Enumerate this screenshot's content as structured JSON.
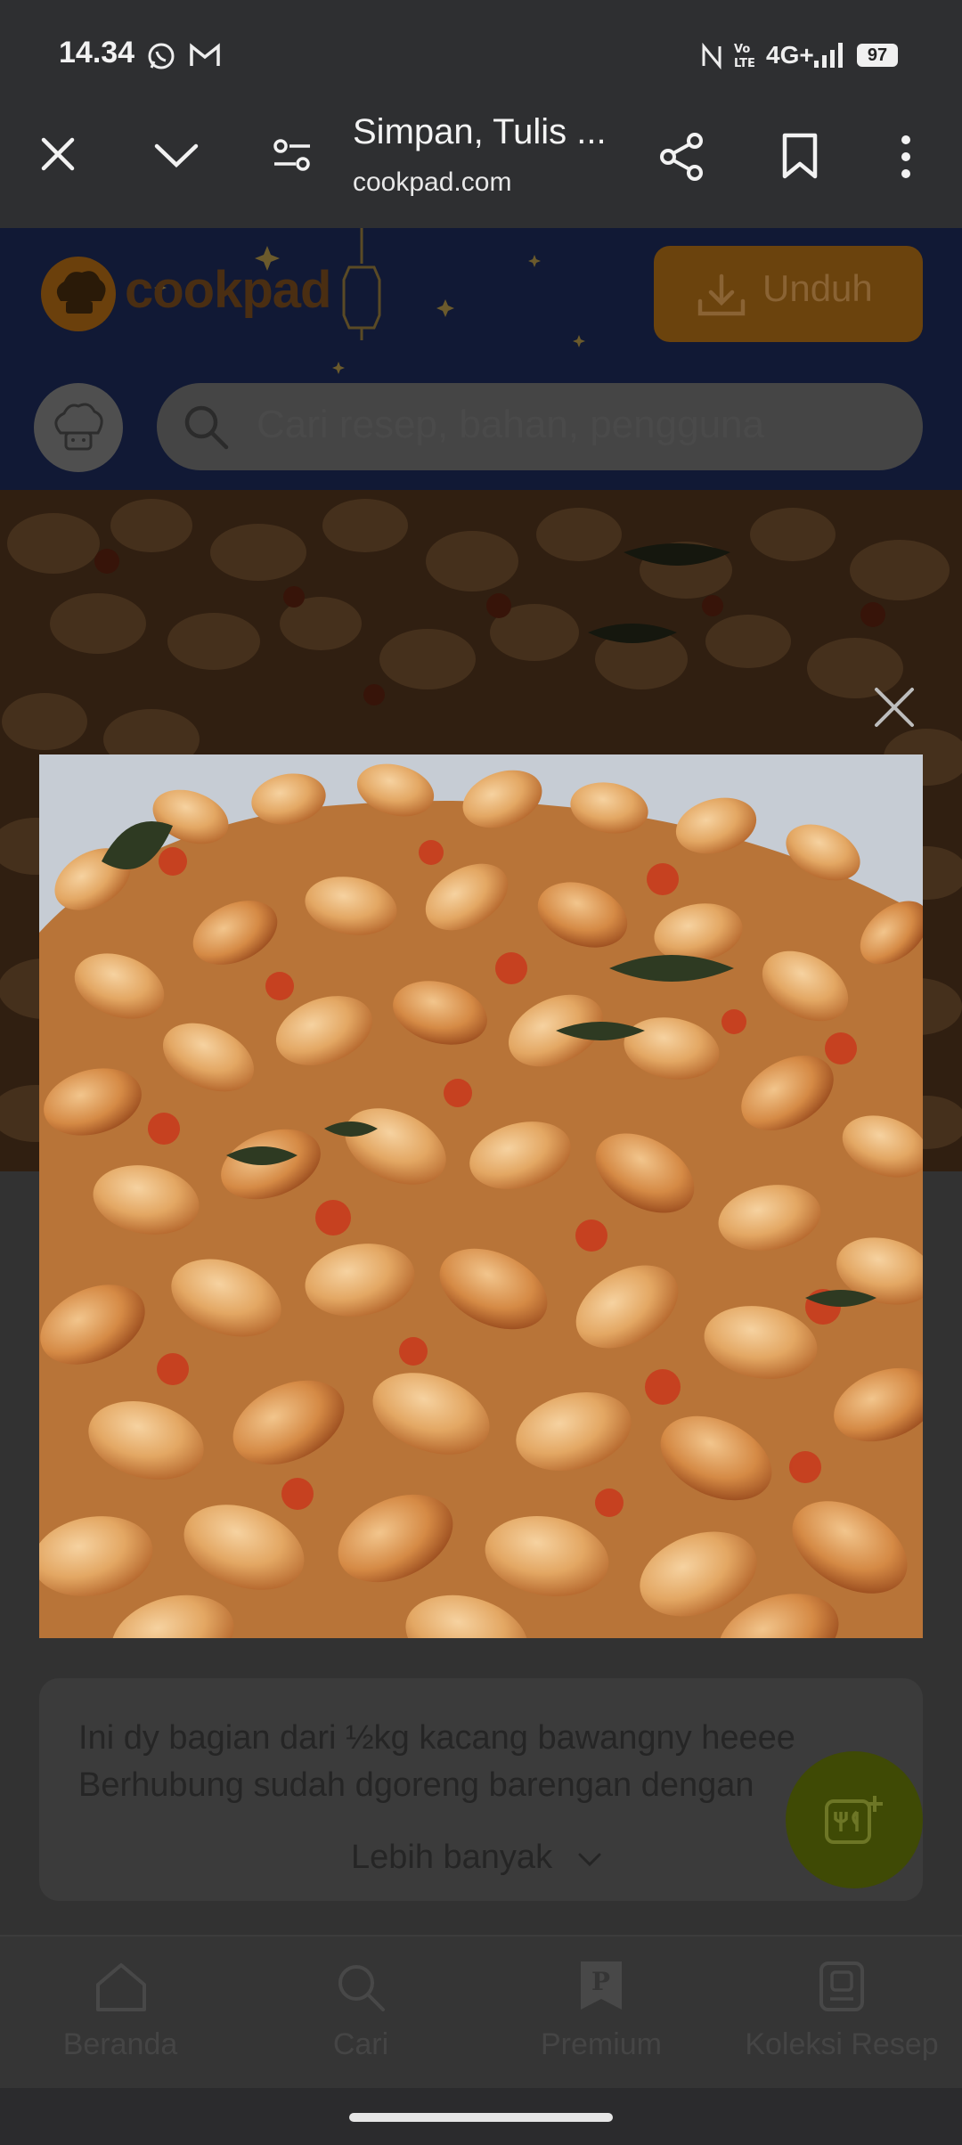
{
  "status_bar": {
    "time": "14.34",
    "network": "4G+",
    "battery": "97"
  },
  "browser": {
    "tab_title": "Simpan, Tulis ...",
    "tab_url": "cookpad.com"
  },
  "header": {
    "logo": "cookpad",
    "download_label": "Unduh",
    "search_placeholder": "Cari resep, bahan, pengguna"
  },
  "recipe": {
    "description_line1": "Ini dy bagian dari ½kg kacang bawangny heeee",
    "description_line2": "Berhubung sudah dgoreng barengan dengan",
    "more_label": "Lebih banyak"
  },
  "bottom_nav": {
    "items": [
      {
        "label": "Beranda",
        "icon": "home-icon"
      },
      {
        "label": "Cari",
        "icon": "search-icon"
      },
      {
        "label": "Premium",
        "icon": "premium-icon"
      },
      {
        "label": "Koleksi Resep",
        "icon": "collection-icon"
      }
    ]
  },
  "colors": {
    "accent": "#e8a13a",
    "fab": "#8fa80c"
  }
}
